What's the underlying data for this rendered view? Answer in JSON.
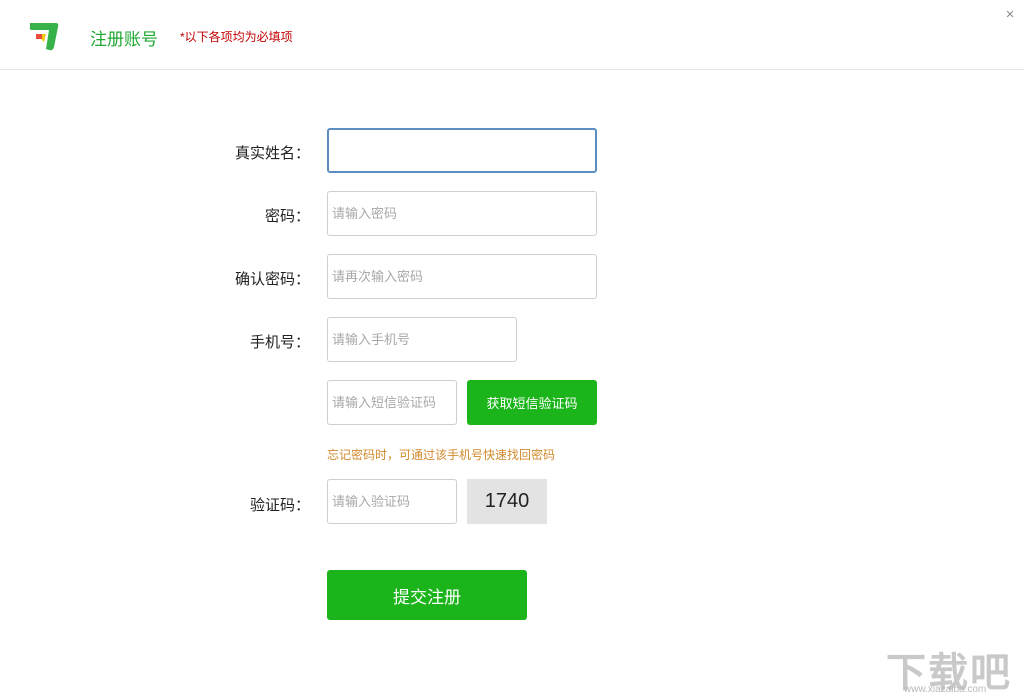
{
  "header": {
    "title": "注册账号",
    "subtitle": "*以下各项均为必填项",
    "close": "×"
  },
  "form": {
    "fields": [
      {
        "label": "真实姓名：",
        "placeholder": "",
        "value": ""
      },
      {
        "label": "密码：",
        "placeholder": "请输入密码",
        "value": ""
      },
      {
        "label": "确认密码：",
        "placeholder": "请再次输入密码",
        "value": ""
      },
      {
        "label": "手机号：",
        "placeholder": "请输入手机号",
        "value": ""
      }
    ],
    "sms_code": {
      "placeholder": "请输入短信验证码",
      "value": ""
    },
    "sms_button": "获取短信验证码",
    "hint": "忘记密码时，可通过该手机号快速找回密码",
    "captcha": {
      "label": "验证码：",
      "placeholder": "请输入验证码",
      "value": "",
      "code": "1740"
    },
    "submit": "提交注册"
  },
  "watermark": {
    "text": "下载吧",
    "url": "www.xiazaiba.com"
  },
  "colors": {
    "accent": "#1bb51b",
    "title": "#1fa832",
    "required": "#c40000",
    "hint": "#d08a2c"
  }
}
